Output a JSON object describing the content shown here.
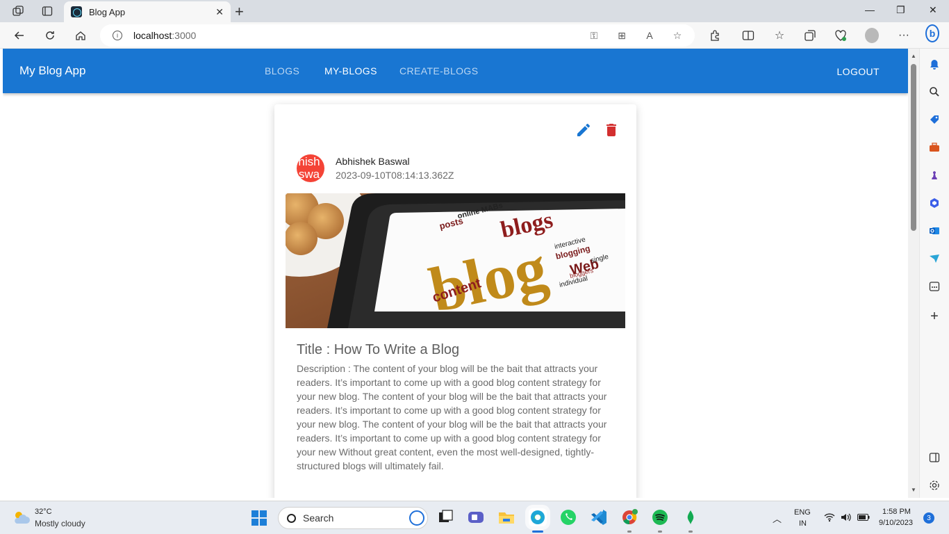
{
  "browser": {
    "tab_title": "Blog App",
    "url_host": "localhost",
    "url_port": ":3000"
  },
  "app": {
    "brand": "My Blog App",
    "nav": [
      {
        "label": "BLOGS",
        "active": false
      },
      {
        "label": "MY-BLOGS",
        "active": true
      },
      {
        "label": "CREATE-BLOGS",
        "active": false
      }
    ],
    "logout_label": "LOGOUT"
  },
  "post": {
    "avatar_text_line1": "hish",
    "avatar_text_line2": "swa",
    "author": "Abhishek Baswal",
    "date": "2023-09-10T08:14:13.362Z",
    "title": "Title : How To Write a Blog",
    "description": "Description : The content of your blog will be the bait that attracts your readers. It’s important to come up with a good blog content strategy for your new blog. The content of your blog will be the bait that attracts your readers. It’s important to come up with a good blog content strategy for your new blog. The content of your blog will be the bait that attracts your readers. It’s important to come up with a good blog content strategy for your new Without great content, even the most well-designed, tightly-structured blogs will ultimately fail.",
    "image_words": {
      "main": "blog",
      "blogs": "blogs",
      "content": "content",
      "web": "Web",
      "posts": "posts",
      "online": "online MABs",
      "bloggers": "bloggers",
      "blogging": "blogging",
      "interactive": "interactive",
      "single": "single",
      "individual": "individual"
    }
  },
  "taskbar": {
    "weather_temp": "32°C",
    "weather_desc": "Mostly cloudy",
    "search_label": "Search",
    "lang_line1": "ENG",
    "lang_line2": "IN",
    "time": "1:58 PM",
    "date": "9/10/2023",
    "notification_count": "3"
  },
  "colors": {
    "appbar": "#1976d2",
    "edit_icon": "#1976d2",
    "delete_icon": "#d32f2f",
    "avatar": "#f44336"
  }
}
